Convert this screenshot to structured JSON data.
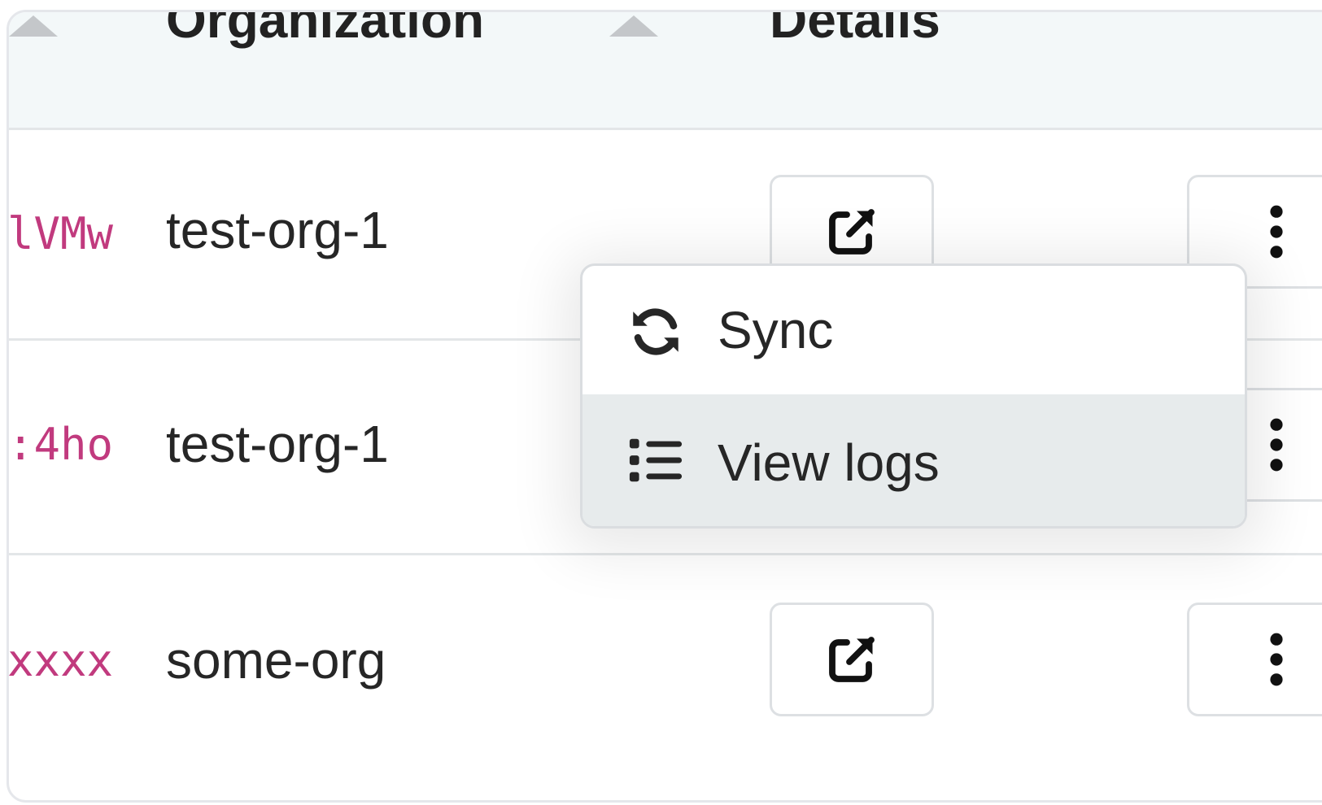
{
  "table": {
    "columns": [
      {
        "label": "Organization"
      },
      {
        "label": "Details"
      }
    ],
    "rows": [
      {
        "id_fragment": "lVMw",
        "organization": "test-org-1",
        "details_icon": "external-link-icon",
        "actions_icon": "vertical-ellipsis-icon"
      },
      {
        "id_fragment": ":4ho",
        "organization": "test-org-1",
        "details_icon": "external-link-icon",
        "actions_icon": "vertical-ellipsis-icon"
      },
      {
        "id_fragment": "xxxx",
        "organization": "some-org",
        "details_icon": "external-link-icon",
        "actions_icon": "vertical-ellipsis-icon"
      }
    ]
  },
  "dropdown_menu": {
    "items": [
      {
        "label": "Sync",
        "icon": "sync-icon",
        "highlighted": false
      },
      {
        "label": "View logs",
        "icon": "list-icon",
        "highlighted": true
      }
    ]
  },
  "colors": {
    "id_text": "#c13a7e",
    "header_bg": "#f3f8f9",
    "highlight_bg": "#e7ebec"
  }
}
